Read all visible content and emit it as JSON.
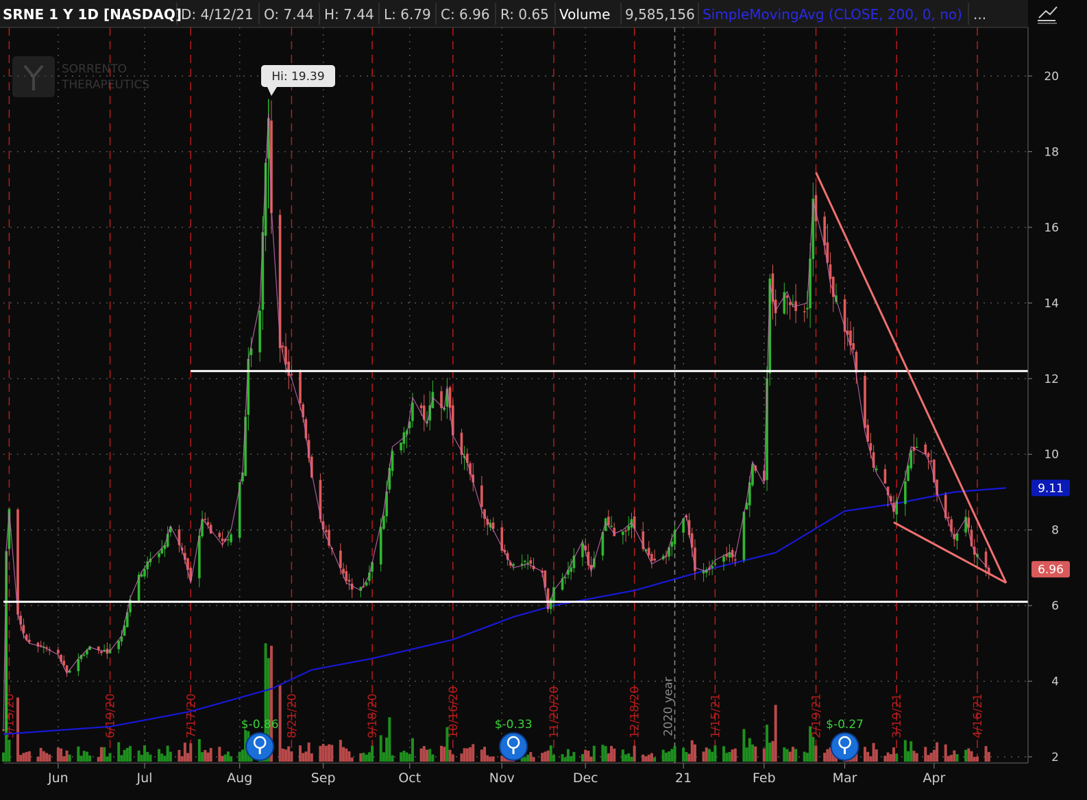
{
  "header": {
    "symbol": "SRNE 1 Y 1D [NASDAQ]",
    "date": "D: 4/12/21",
    "open": "O: 7.44",
    "high": "H: 7.44",
    "low": "L: 6.79",
    "close": "C: 6.96",
    "range": "R: 0.65",
    "volume_label": "Volume",
    "volume_value": "9,585,156",
    "study": "SimpleMovingAvg (CLOSE, 200, 0, no)",
    "more": "..."
  },
  "logo": {
    "line1": "SORRENTO",
    "line2": "THERAPEUTICS"
  },
  "colors": {
    "background": "#0b0b0b",
    "grid": "#5a5a5a",
    "up": "#2fb82f",
    "down": "#e05a5a",
    "sma": "#1818d8",
    "trend_line": "#f07070",
    "support_line": "#ffffff",
    "expiration_line": "#b81c1c",
    "header_bg": "#1a1a1a",
    "study_text": "#2a2ae8",
    "sma_badge": "#0a1ab8",
    "close_badge": "#d95a5a"
  },
  "chart_data": {
    "type": "candlestick",
    "symbol": "SRNE",
    "interval": "1 day",
    "ylim": [
      2,
      21
    ],
    "y_ticks": [
      2,
      4,
      6,
      8,
      10,
      12,
      14,
      16,
      18,
      20
    ],
    "x_month_labels": [
      {
        "label": "Jun",
        "date": "2020-06-01"
      },
      {
        "label": "Jul",
        "date": "2020-07-01"
      },
      {
        "label": "Aug",
        "date": "2020-08-03"
      },
      {
        "label": "Sep",
        "date": "2020-09-01"
      },
      {
        "label": "Oct",
        "date": "2020-10-01"
      },
      {
        "label": "Nov",
        "date": "2020-11-02"
      },
      {
        "label": "Dec",
        "date": "2020-12-01"
      },
      {
        "label": "21",
        "date": "2021-01-04"
      },
      {
        "label": "Feb",
        "date": "2021-02-01"
      },
      {
        "label": "Mar",
        "date": "2021-03-01"
      },
      {
        "label": "Apr",
        "date": "2021-04-01"
      }
    ],
    "expiration_labels": [
      {
        "label": "5/15/20",
        "date": "2020-05-15"
      },
      {
        "label": "6/19/20",
        "date": "2020-06-19"
      },
      {
        "label": "7/17/20",
        "date": "2020-07-17"
      },
      {
        "label": "8/21/20",
        "date": "2020-08-21"
      },
      {
        "label": "9/18/20",
        "date": "2020-09-18"
      },
      {
        "label": "10/16/20",
        "date": "2020-10-16"
      },
      {
        "label": "11/20/20",
        "date": "2020-11-20"
      },
      {
        "label": "12/18/20",
        "date": "2020-12-18"
      },
      {
        "label": "1/15/21",
        "date": "2021-01-15"
      },
      {
        "label": "2/19/21",
        "date": "2021-02-19"
      },
      {
        "label": "3/19/21",
        "date": "2021-03-19"
      },
      {
        "label": "4/16/21",
        "date": "2021-04-16"
      }
    ],
    "year_marker": {
      "label": "2020 year",
      "date": "2021-01-01"
    },
    "price_path": [
      [
        "2020-05-13",
        2.7
      ],
      [
        "2020-05-14",
        7.5
      ],
      [
        "2020-05-15",
        8.5
      ],
      [
        "2020-05-18",
        5.8
      ],
      [
        "2020-05-20",
        5.2
      ],
      [
        "2020-05-22",
        5.0
      ],
      [
        "2020-05-27",
        4.9
      ],
      [
        "2020-06-01",
        4.7
      ],
      [
        "2020-06-04",
        4.2
      ],
      [
        "2020-06-08",
        4.6
      ],
      [
        "2020-06-12",
        4.9
      ],
      [
        "2020-06-16",
        4.8
      ],
      [
        "2020-06-19",
        4.8
      ],
      [
        "2020-06-23",
        5.2
      ],
      [
        "2020-06-26",
        6.2
      ],
      [
        "2020-06-30",
        6.9
      ],
      [
        "2020-07-03",
        7.2
      ],
      [
        "2020-07-08",
        7.6
      ],
      [
        "2020-07-10",
        8.1
      ],
      [
        "2020-07-14",
        7.5
      ],
      [
        "2020-07-17",
        6.6
      ],
      [
        "2020-07-21",
        8.3
      ],
      [
        "2020-07-24",
        8.0
      ],
      [
        "2020-07-28",
        7.6
      ],
      [
        "2020-07-31",
        8.0
      ],
      [
        "2020-08-04",
        9.5
      ],
      [
        "2020-08-06",
        12.5
      ],
      [
        "2020-08-10",
        14.0
      ],
      [
        "2020-08-12",
        17.5
      ],
      [
        "2020-08-13",
        19.0
      ],
      [
        "2020-08-14",
        16.5
      ],
      [
        "2020-08-17",
        13.0
      ],
      [
        "2020-08-19",
        12.3
      ],
      [
        "2020-08-21",
        12.0
      ],
      [
        "2020-08-25",
        11.0
      ],
      [
        "2020-08-28",
        9.5
      ],
      [
        "2020-09-01",
        8.0
      ],
      [
        "2020-09-04",
        7.5
      ],
      [
        "2020-09-09",
        6.6
      ],
      [
        "2020-09-14",
        6.4
      ],
      [
        "2020-09-17",
        6.8
      ],
      [
        "2020-09-22",
        8.5
      ],
      [
        "2020-09-25",
        10.2
      ],
      [
        "2020-09-30",
        10.5
      ],
      [
        "2020-10-02",
        11.5
      ],
      [
        "2020-10-07",
        10.8
      ],
      [
        "2020-10-09",
        11.5
      ],
      [
        "2020-10-13",
        11.2
      ],
      [
        "2020-10-14",
        11.8
      ],
      [
        "2020-10-16",
        10.5
      ],
      [
        "2020-10-21",
        9.8
      ],
      [
        "2020-10-26",
        8.5
      ],
      [
        "2020-10-30",
        8.0
      ],
      [
        "2020-11-03",
        7.4
      ],
      [
        "2020-11-06",
        7.0
      ],
      [
        "2020-11-11",
        7.1
      ],
      [
        "2020-11-16",
        6.9
      ],
      [
        "2020-11-18",
        5.9
      ],
      [
        "2020-11-20",
        6.4
      ],
      [
        "2020-11-24",
        6.8
      ],
      [
        "2020-11-30",
        7.7
      ],
      [
        "2020-12-03",
        6.9
      ],
      [
        "2020-12-08",
        8.2
      ],
      [
        "2020-12-11",
        7.9
      ],
      [
        "2020-12-14",
        8.0
      ],
      [
        "2020-12-17",
        8.2
      ],
      [
        "2020-12-21",
        7.6
      ],
      [
        "2020-12-24",
        7.1
      ],
      [
        "2020-12-29",
        7.3
      ],
      [
        "2020-12-31",
        7.8
      ],
      [
        "2021-01-05",
        8.4
      ],
      [
        "2021-01-08",
        7.0
      ],
      [
        "2021-01-12",
        6.9
      ],
      [
        "2021-01-15",
        7.2
      ],
      [
        "2021-01-20",
        7.4
      ],
      [
        "2021-01-22",
        7.3
      ],
      [
        "2021-01-26",
        8.8
      ],
      [
        "2021-01-28",
        9.8
      ],
      [
        "2021-02-01",
        9.2
      ],
      [
        "2021-02-03",
        14.5
      ],
      [
        "2021-02-05",
        13.8
      ],
      [
        "2021-02-09",
        14.3
      ],
      [
        "2021-02-11",
        13.9
      ],
      [
        "2021-02-16",
        14.0
      ],
      [
        "2021-02-18",
        16.7
      ],
      [
        "2021-02-22",
        15.5
      ],
      [
        "2021-02-24",
        14.5
      ],
      [
        "2021-02-26",
        14.1
      ],
      [
        "2021-03-02",
        13.1
      ],
      [
        "2021-03-04",
        12.6
      ],
      [
        "2021-03-08",
        10.6
      ],
      [
        "2021-03-10",
        10.0
      ],
      [
        "2021-03-12",
        9.5
      ],
      [
        "2021-03-16",
        9.0
      ],
      [
        "2021-03-18",
        8.5
      ],
      [
        "2021-03-22",
        9.4
      ],
      [
        "2021-03-24",
        10.2
      ],
      [
        "2021-03-29",
        10.0
      ],
      [
        "2021-03-31",
        9.7
      ],
      [
        "2021-04-02",
        9.0
      ],
      [
        "2021-04-06",
        8.2
      ],
      [
        "2021-04-08",
        7.8
      ],
      [
        "2021-04-12",
        8.3
      ],
      [
        "2021-04-14",
        7.6
      ],
      [
        "2021-04-16",
        7.3
      ],
      [
        "2021-04-20",
        6.96
      ]
    ],
    "sma_200": [
      [
        "2020-05-13",
        2.6
      ],
      [
        "2020-06-19",
        2.8
      ],
      [
        "2020-07-17",
        3.2
      ],
      [
        "2020-08-14",
        3.8
      ],
      [
        "2020-08-28",
        4.3
      ],
      [
        "2020-09-18",
        4.6
      ],
      [
        "2020-10-16",
        5.1
      ],
      [
        "2020-11-06",
        5.7
      ],
      [
        "2020-11-20",
        6.0
      ],
      [
        "2020-12-18",
        6.4
      ],
      [
        "2021-01-15",
        7.0
      ],
      [
        "2021-02-05",
        7.4
      ],
      [
        "2021-03-01",
        8.5
      ],
      [
        "2021-03-19",
        8.7
      ],
      [
        "2021-04-08",
        9.0
      ],
      [
        "2021-04-26",
        9.11
      ]
    ],
    "volume_max": 5000000,
    "volume_spikes_millions": [
      [
        "2020-05-14",
        4.3
      ],
      [
        "2020-05-18",
        2.6
      ],
      [
        "2020-08-12",
        4.8
      ],
      [
        "2020-08-13",
        4.2
      ],
      [
        "2020-08-14",
        4.7
      ],
      [
        "2020-08-17",
        3.1
      ],
      [
        "2020-09-24",
        1.8
      ],
      [
        "2020-10-14",
        1.4
      ],
      [
        "2021-02-02",
        1.5
      ],
      [
        "2021-02-05",
        2.3
      ],
      [
        "2021-02-18",
        1.0
      ],
      [
        "2021-03-08",
        0.6
      ]
    ],
    "horizontal_levels": [
      {
        "value": 12.2,
        "from": "2020-07-17"
      },
      {
        "value": 6.1,
        "from": "2020-05-13"
      }
    ],
    "trend_lines": [
      {
        "from": [
          "2021-02-19",
          17.45
        ],
        "to": [
          "2021-04-26",
          6.6
        ]
      },
      {
        "from": [
          "2021-03-18",
          8.2
        ],
        "to": [
          "2021-04-26",
          6.6
        ]
      }
    ],
    "earnings": [
      {
        "date": "2020-08-10",
        "label": "$-0.86"
      },
      {
        "date": "2020-11-06",
        "label": "$-0.33"
      },
      {
        "date": "2021-03-01",
        "label": "$-0.27"
      }
    ],
    "annotations": {
      "high": {
        "label": "Hi: 19.39",
        "date": "2020-08-13",
        "value": 19.39
      },
      "sma_badge": {
        "label": "9.11",
        "value": 9.11
      },
      "close_badge": {
        "label": "6.96",
        "value": 6.96
      }
    }
  }
}
